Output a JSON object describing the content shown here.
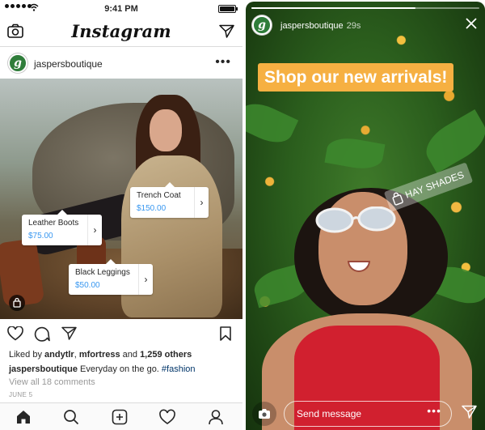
{
  "statusbar": {
    "time": "9:41 PM",
    "battery_level": 0.9
  },
  "feed": {
    "logo": "Instagram",
    "post": {
      "username": "jaspersboutique",
      "avatar_letter": "g",
      "more": "•••",
      "product_tags": [
        {
          "name": "Trench Coat",
          "price": "$150.00"
        },
        {
          "name": "Leather Boots",
          "price": "$75.00"
        },
        {
          "name": "Black Leggings",
          "price": "$50.00"
        }
      ],
      "likes_prefix": "Liked by ",
      "liker_1": "andytlr",
      "separator": ", ",
      "liker_2": "mfortress",
      "and": " and ",
      "others": "1,259 others",
      "caption_user": "jaspersboutique",
      "caption_text": " Everyday on the go. ",
      "caption_hashtag": "#fashion",
      "comments_link": "View all 18 comments",
      "date": "JUNE 5"
    }
  },
  "story": {
    "username": "jaspersboutique",
    "age": "29s",
    "avatar_letter": "g",
    "progress": 0.72,
    "banner": "Shop our new arrivals!",
    "sticker": "HAY SHADES",
    "reply_placeholder": "Send message",
    "more": "•••"
  },
  "icons": [
    "camera-icon",
    "direct-icon",
    "heart-icon",
    "comment-icon",
    "share-icon",
    "bookmark-icon",
    "home-icon",
    "search-icon",
    "add-icon",
    "activity-icon",
    "profile-icon",
    "close-icon",
    "shopping-bag-icon",
    "chevron-right-icon"
  ],
  "colors": {
    "link_blue": "#3897f0",
    "hashtag": "#003569",
    "banner_orange": "#f6b042"
  }
}
